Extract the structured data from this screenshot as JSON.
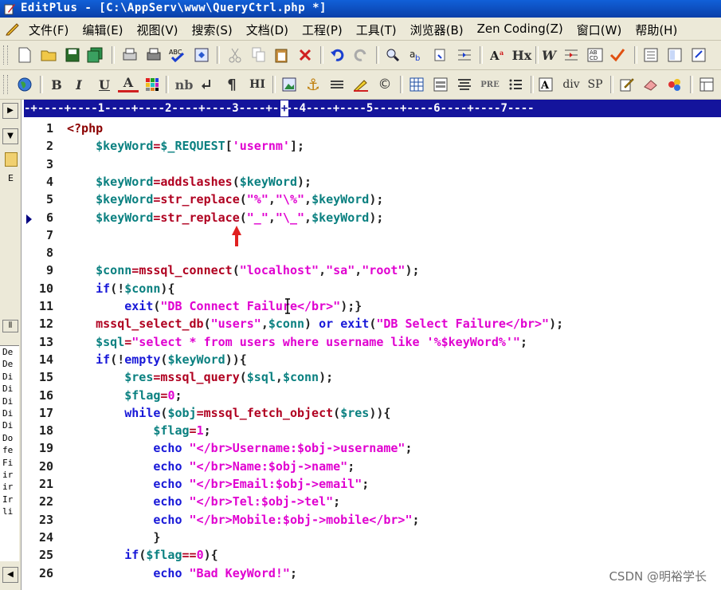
{
  "window": {
    "title": "EditPlus - [C:\\AppServ\\www\\QueryCtrl.php *]"
  },
  "menu": [
    "文件(F)",
    "编辑(E)",
    "视图(V)",
    "搜索(S)",
    "文档(D)",
    "工程(P)",
    "工具(T)",
    "浏览器(B)",
    "Zen Coding(Z)",
    "窗口(W)",
    "帮助(H)"
  ],
  "toolbar2_text": {
    "bold": "B",
    "italic": "I",
    "underline": "U",
    "font_color": "A",
    "nb": "nb",
    "hr": "HI",
    "pre": "PRE",
    "div": "div",
    "sp": "SP",
    "hx": "Hx",
    "w": "W"
  },
  "ruler": "-+----+----1----+----2----+----3----+----4----+----5----+----6----+----7----",
  "file_list": [
    "De",
    "De",
    "Di",
    "Di",
    "Di",
    "Di",
    "Di",
    "Do",
    "fe",
    "Fi",
    "ir",
    "ir",
    "Ir",
    "li"
  ],
  "lines": [
    {
      "n": "1",
      "code": "<?php"
    },
    {
      "n": "2",
      "code": "    $keyWord=$_REQUEST['usernm'];"
    },
    {
      "n": "3",
      "code": ""
    },
    {
      "n": "4",
      "code": "    $keyWord=addslashes($keyWord);"
    },
    {
      "n": "5",
      "code": "    $keyWord=str_replace(\"%\",\"\\%\",$keyWord);"
    },
    {
      "n": "6",
      "code": "    $keyWord=str_replace(\"_\",\"\\_\",$keyWord);"
    },
    {
      "n": "7",
      "code": ""
    },
    {
      "n": "8",
      "code": ""
    },
    {
      "n": "9",
      "code": "    $conn=mssql_connect(\"localhost\",\"sa\",\"root\");"
    },
    {
      "n": "10",
      "code": "    if(!$conn){"
    },
    {
      "n": "11",
      "code": "        exit(\"DB Connect Failure</br>\");}"
    },
    {
      "n": "12",
      "code": "    mssql_select_db(\"users\",$conn) or exit(\"DB Select Failure</br>\");"
    },
    {
      "n": "13",
      "code": "    $sql=\"select * from users where username like '%$keyWord%'\";"
    },
    {
      "n": "14",
      "code": "    if(!empty($keyWord)){"
    },
    {
      "n": "15",
      "code": "        $res=mssql_query($sql,$conn);"
    },
    {
      "n": "16",
      "code": "        $flag=0;"
    },
    {
      "n": "17",
      "code": "        while($obj=mssql_fetch_object($res)){"
    },
    {
      "n": "18",
      "code": "            $flag=1;"
    },
    {
      "n": "19",
      "code": "            echo \"</br>Username:$obj->username\";"
    },
    {
      "n": "20",
      "code": "            echo \"</br>Name:$obj->name\";"
    },
    {
      "n": "21",
      "code": "            echo \"</br>Email:$obj->email\";"
    },
    {
      "n": "22",
      "code": "            echo \"</br>Tel:$obj->tel\";"
    },
    {
      "n": "23",
      "code": "            echo \"</br>Mobile:$obj->mobile</br>\";"
    },
    {
      "n": "24",
      "code": "            }"
    },
    {
      "n": "25",
      "code": "        if($flag==0){"
    },
    {
      "n": "26",
      "code": "            echo \"Bad KeyWord!\";"
    }
  ],
  "current_line": "6",
  "watermark": "CSDN @明裕学长",
  "colors": {
    "variable": "#0a8080",
    "function": "#b00020",
    "string": "#e000d0",
    "keyword": "#1818d8",
    "ruler": "#14149c",
    "titlebar": "#0a3fa8",
    "arrow": "#e02020"
  }
}
